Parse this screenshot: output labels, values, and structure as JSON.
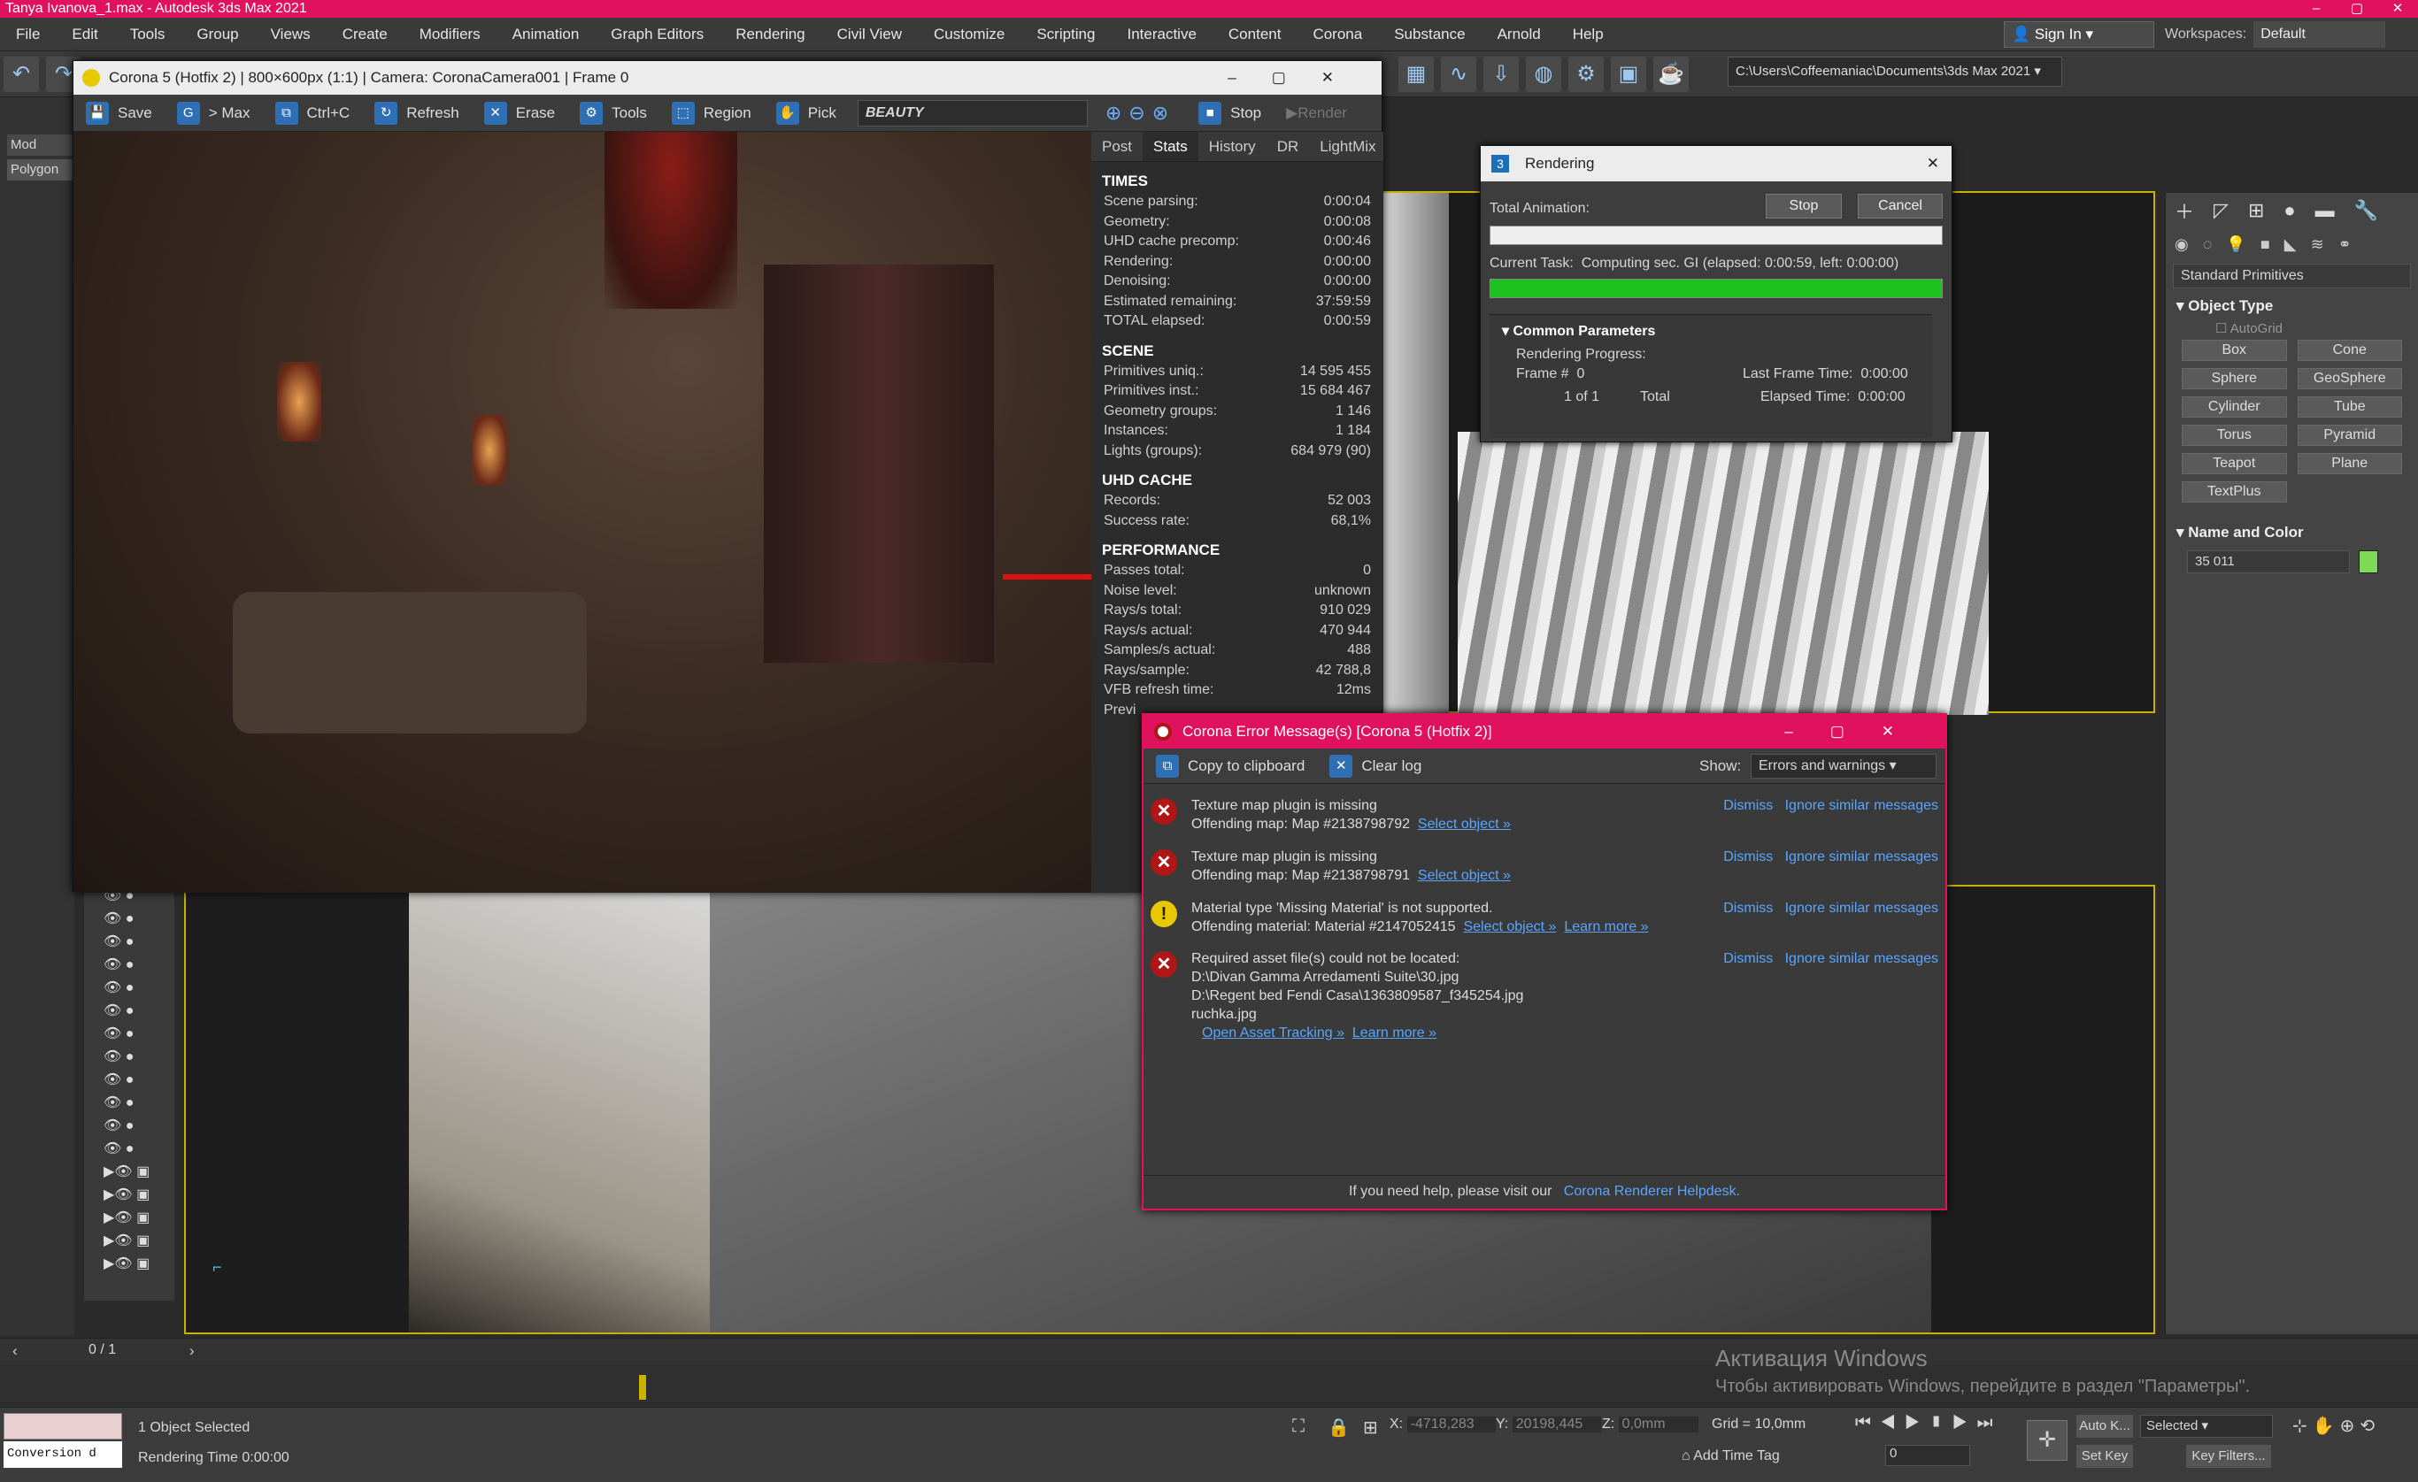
{
  "window": {
    "title": "Tanya Ivanova_1.max - Autodesk 3ds Max 2021"
  },
  "menu": [
    "File",
    "Edit",
    "Tools",
    "Group",
    "Views",
    "Create",
    "Modifiers",
    "Animation",
    "Graph Editors",
    "Rendering",
    "Civil View",
    "Customize",
    "Scripting",
    "Interactive",
    "Content",
    "Corona",
    "Substance",
    "Arnold",
    "Help"
  ],
  "account": {
    "signin": "Sign In",
    "workspaces_label": "Workspaces:",
    "workspace": "Default"
  },
  "project_path": "C:\\Users\\Coffeemaniac\\Documents\\3ds Max 2021",
  "left_panel": {
    "tab_mod": "Mod",
    "tab_polygon": "Polygon",
    "counter": "0 / 1"
  },
  "vfb": {
    "title": "Corona 5 (Hotfix 2) | 800×600px (1:1) | Camera: CoronaCamera001 | Frame 0",
    "toolbar": {
      "save": "Save",
      "max": "> Max",
      "ctrlc": "Ctrl+C",
      "refresh": "Refresh",
      "erase": "Erase",
      "tools": "Tools",
      "region": "Region",
      "pick": "Pick",
      "pass": "BEAUTY",
      "stop": "Stop",
      "render": "Render"
    },
    "tabs": [
      "Post",
      "Stats",
      "History",
      "DR",
      "LightMix"
    ],
    "stats": {
      "times_title": "TIMES",
      "times": [
        [
          "Scene parsing:",
          "0:00:04"
        ],
        [
          "Geometry:",
          "0:00:08"
        ],
        [
          "UHD cache precomp:",
          "0:00:46"
        ],
        [
          "Rendering:",
          "0:00:00"
        ],
        [
          "Denoising:",
          "0:00:00"
        ],
        [
          "Estimated remaining:",
          "37:59:59"
        ],
        [
          "TOTAL elapsed:",
          "0:00:59"
        ]
      ],
      "scene_title": "SCENE",
      "scene": [
        [
          "Primitives uniq.:",
          "14 595 455"
        ],
        [
          "Primitives inst.:",
          "15 684 467"
        ],
        [
          "Geometry groups:",
          "1 146"
        ],
        [
          "Instances:",
          "1 184"
        ],
        [
          "Lights (groups):",
          "684 979 (90)"
        ]
      ],
      "uhd_title": "UHD CACHE",
      "uhd": [
        [
          "Records:",
          "52 003"
        ],
        [
          "Success rate:",
          "68,1%"
        ]
      ],
      "perf_title": "PERFORMANCE",
      "perf": [
        [
          "Passes total:",
          "0"
        ],
        [
          "Noise level:",
          "unknown"
        ],
        [
          "Rays/s total:",
          "910 029"
        ],
        [
          "Rays/s actual:",
          "470 944"
        ],
        [
          "Samples/s actual:",
          "488"
        ],
        [
          "Rays/sample:",
          "42 788,8"
        ],
        [
          "VFB refresh time:",
          "12ms"
        ],
        [
          "Previ",
          ""
        ]
      ]
    }
  },
  "rendering_dialog": {
    "title": "Rendering",
    "total_animation": "Total Animation:",
    "stop": "Stop",
    "cancel": "Cancel",
    "current_task_label": "Current Task:",
    "current_task": "Computing sec. GI (elapsed: 0:00:59, left: 0:00:00)",
    "progress": 1.0,
    "section": "Common Parameters",
    "rendering_progress": "Rendering Progress:",
    "frame_label": "Frame #",
    "frame": "0",
    "of": "1 of 1",
    "total": "Total",
    "last_frame_label": "Last Frame Time:",
    "last_frame": "0:00:00",
    "elapsed_label": "Elapsed Time:",
    "elapsed": "0:00:00"
  },
  "error_dialog": {
    "title": "Corona Error Message(s)    [Corona 5 (Hotfix 2)]",
    "copy": "Copy to clipboard",
    "clear": "Clear log",
    "show_label": "Show:",
    "show_value": "Errors and warnings",
    "dismiss": "Dismiss",
    "ignore": "Ignore similar messages",
    "messages": [
      {
        "line1": "Texture map plugin is missing",
        "line2": "Offending map: Map #2138798792",
        "link": "Select object »"
      },
      {
        "line1": "Texture map plugin is missing",
        "line2": "Offending map: Map #2138798791",
        "link": "Select object »"
      },
      {
        "line1": "Material type 'Missing Material' is not supported.",
        "line2": "Offending material: Material #2147052415",
        "link": "Select object »",
        "link2": "Learn more »"
      },
      {
        "line1": "Required asset file(s) could not be located:",
        "line2": "D:\\Divan Gamma Arredamenti Suite\\30.jpg",
        "line3": "D:\\Regent bed Fendi Casa\\1363809587_f345254.jpg",
        "line4": "ruchka.jpg",
        "link": "Open Asset Tracking »",
        "link2": "Learn more »"
      }
    ],
    "footer": "If you need help, please visit our",
    "footer_link": "Corona Renderer Helpdesk."
  },
  "command_panel": {
    "dropdown": "Standard Primitives",
    "object_type": "Object Type",
    "autogrid": "AutoGrid",
    "primitives": [
      "Box",
      "Cone",
      "Sphere",
      "GeoSphere",
      "Cylinder",
      "Tube",
      "Torus",
      "Pyramid",
      "Teapot",
      "Plane",
      "TextPlus"
    ],
    "name_color": "Name and Color",
    "name_value": "35   011",
    "color": "#7ed957"
  },
  "watermark": {
    "line1": "Активация Windows",
    "line2": "Чтобы активировать Windows, перейдите в раздел \"Параметры\"."
  },
  "status": {
    "selected": "1 Object Selected",
    "render_time": "Rendering Time  0:00:00",
    "conversion": "Conversion d",
    "x_label": "X:",
    "x": "-4718,283",
    "y_label": "Y:",
    "y": "20198,445",
    "z_label": "Z:",
    "z": "0,0mm",
    "grid": "Grid = 10,0mm",
    "add_time_tag": "Add Time Tag",
    "auto_key": "Auto K...",
    "selected_set": "Selected",
    "set_key": "Set Key",
    "key_filters": "Key Filters...",
    "frame_field": "0"
  },
  "colors": {
    "accent": "#e0125d",
    "progress": "#1ec21e",
    "link": "#5aa6ff"
  }
}
